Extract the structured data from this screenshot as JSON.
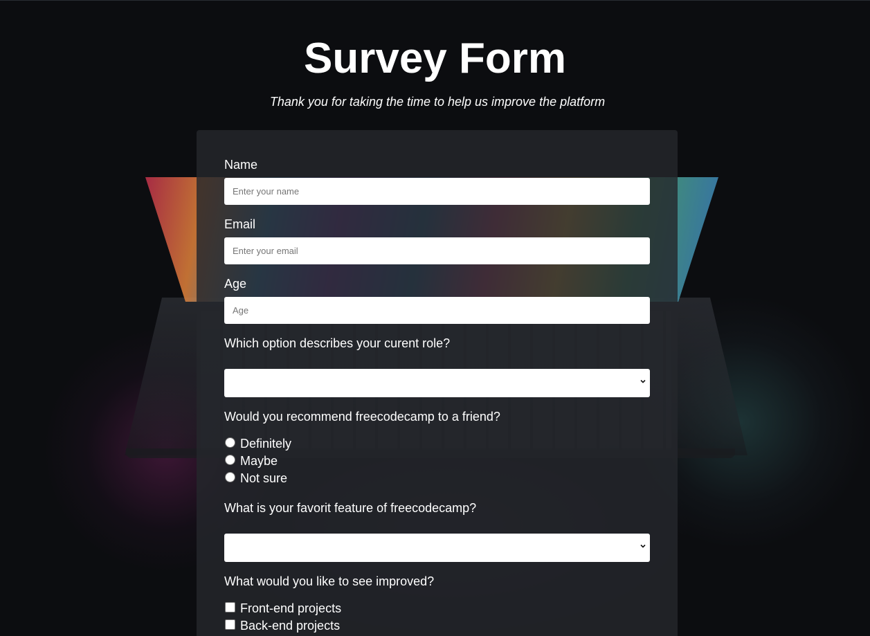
{
  "header": {
    "title": "Survey Form",
    "description": "Thank you for taking the time to help us improve the platform"
  },
  "form": {
    "name": {
      "label": "Name",
      "placeholder": "Enter your name",
      "value": ""
    },
    "email": {
      "label": "Email",
      "placeholder": "Enter your email",
      "value": ""
    },
    "age": {
      "label": "Age",
      "placeholder": "Age",
      "value": ""
    },
    "role": {
      "label": "Which option describes your curent role?",
      "selected": ""
    },
    "recommend": {
      "label": "Would you recommend freecodecamp to a friend?",
      "options": [
        "Definitely",
        "Maybe",
        "Not sure"
      ]
    },
    "feature": {
      "label": "What is your favorit feature of freecodecamp?",
      "selected": ""
    },
    "improve": {
      "label": "What would you like to see improved?",
      "options": [
        "Front-end projects",
        "Back-end projects"
      ]
    }
  },
  "icons": {
    "select_arrow": "chevron-down-icon"
  },
  "colors": {
    "background": "#0c0d10",
    "card": "#24272c",
    "text": "#ffffff",
    "field": "#ffffff"
  }
}
